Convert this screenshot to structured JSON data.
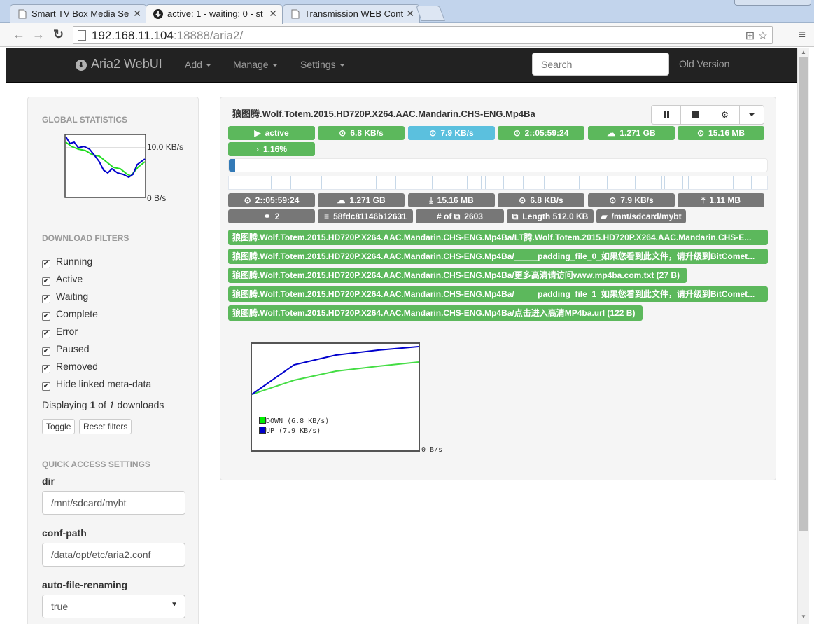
{
  "browser": {
    "tabs": [
      {
        "title": "Smart TV Box Media Se",
        "active": false
      },
      {
        "title": "active: 1 - waiting: 0 - st",
        "active": true
      },
      {
        "title": "Transmission WEB Cont",
        "active": false
      }
    ],
    "url_host": "192.168.11.104",
    "url_rest": ":18888/aria2/"
  },
  "navbar": {
    "brand": "Aria2 WebUI",
    "menus": [
      "Add",
      "Manage",
      "Settings"
    ],
    "search_placeholder": "Search",
    "old_version": "Old Version"
  },
  "sidebar": {
    "global_stats_heading": "Global Statistics",
    "graph_max": "10.0 KB/s",
    "graph_min": "0 B/s",
    "filters_heading": "Download Filters",
    "filters": [
      "Running",
      "Active",
      "Waiting",
      "Complete",
      "Error",
      "Paused",
      "Removed",
      "Hide linked meta-data"
    ],
    "displaying_prefix": "Displaying",
    "displaying_count": "1",
    "displaying_of": "of",
    "displaying_total": "1",
    "displaying_suffix": "downloads",
    "toggle_label": "Toggle",
    "reset_label": "Reset filters",
    "quick_heading": "Quick Access Settings",
    "settings": [
      {
        "label": "dir",
        "value": "/mnt/sdcard/mybt"
      },
      {
        "label": "conf-path",
        "value": "/data/opt/etc/aria2.conf"
      },
      {
        "label": "auto-file-renaming",
        "value": "true"
      }
    ]
  },
  "download": {
    "name": "狼图腾.Wolf.Totem.2015.HD720P.X264.AAC.Mandarin.CHS-ENG.Mp4Ba",
    "status": "active",
    "down_speed": "6.8 KB/s",
    "up_speed": "7.9 KB/s",
    "eta": "2::05:59:24",
    "size": "1.271 GB",
    "downloaded": "15.16 MB",
    "percent_label": "1.16%",
    "progress_fraction": 0.0116,
    "details": {
      "eta": "2::05:59:24",
      "size": "1.271 GB",
      "downloaded": "15.16 MB",
      "down_speed": "6.8 KB/s",
      "up_speed": "7.9 KB/s",
      "uploaded": "1.11 MB",
      "connections": "2",
      "gid": "58fdc81146b12631",
      "pieces_label": "# of",
      "pieces_count": "2603",
      "piece_length_label": "Length",
      "piece_length": "512.0 KB",
      "dir": "/mnt/sdcard/mybt"
    },
    "files": [
      "狼图腾.Wolf.Totem.2015.HD720P.X264.AAC.Mandarin.CHS-ENG.Mp4Ba/LT腾.Wolf.Totem.2015.HD720P.X264.AAC.Mandarin.CHS-E...",
      "狼图腾.Wolf.Totem.2015.HD720P.X264.AAC.Mandarin.CHS-ENG.Mp4Ba/_____padding_file_0_如果您看到此文件，请升级到BitComet...",
      "狼图腾.Wolf.Totem.2015.HD720P.X264.AAC.Mandarin.CHS-ENG.Mp4Ba/更多高清请访问www.mp4ba.com.txt (27 B)",
      "狼图腾.Wolf.Totem.2015.HD720P.X264.AAC.Mandarin.CHS-ENG.Mp4Ba/_____padding_file_1_如果您看到此文件，请升级到BitComet...",
      "狼图腾.Wolf.Totem.2015.HD720P.X264.AAC.Mandarin.CHS-ENG.Mp4Ba/点击进入高清MP4ba.url (122 B)"
    ],
    "graph": {
      "legend_down": "DOWN (6.8 KB/s)",
      "legend_up": "UP (7.9 KB/s)",
      "axis_min": "0 B/s",
      "down_color": "#00ee00",
      "up_color": "#0000cc"
    }
  },
  "colors": {
    "success": "#5cb85c",
    "info": "#5bc0de",
    "default": "#777777",
    "navbar": "#222222"
  }
}
